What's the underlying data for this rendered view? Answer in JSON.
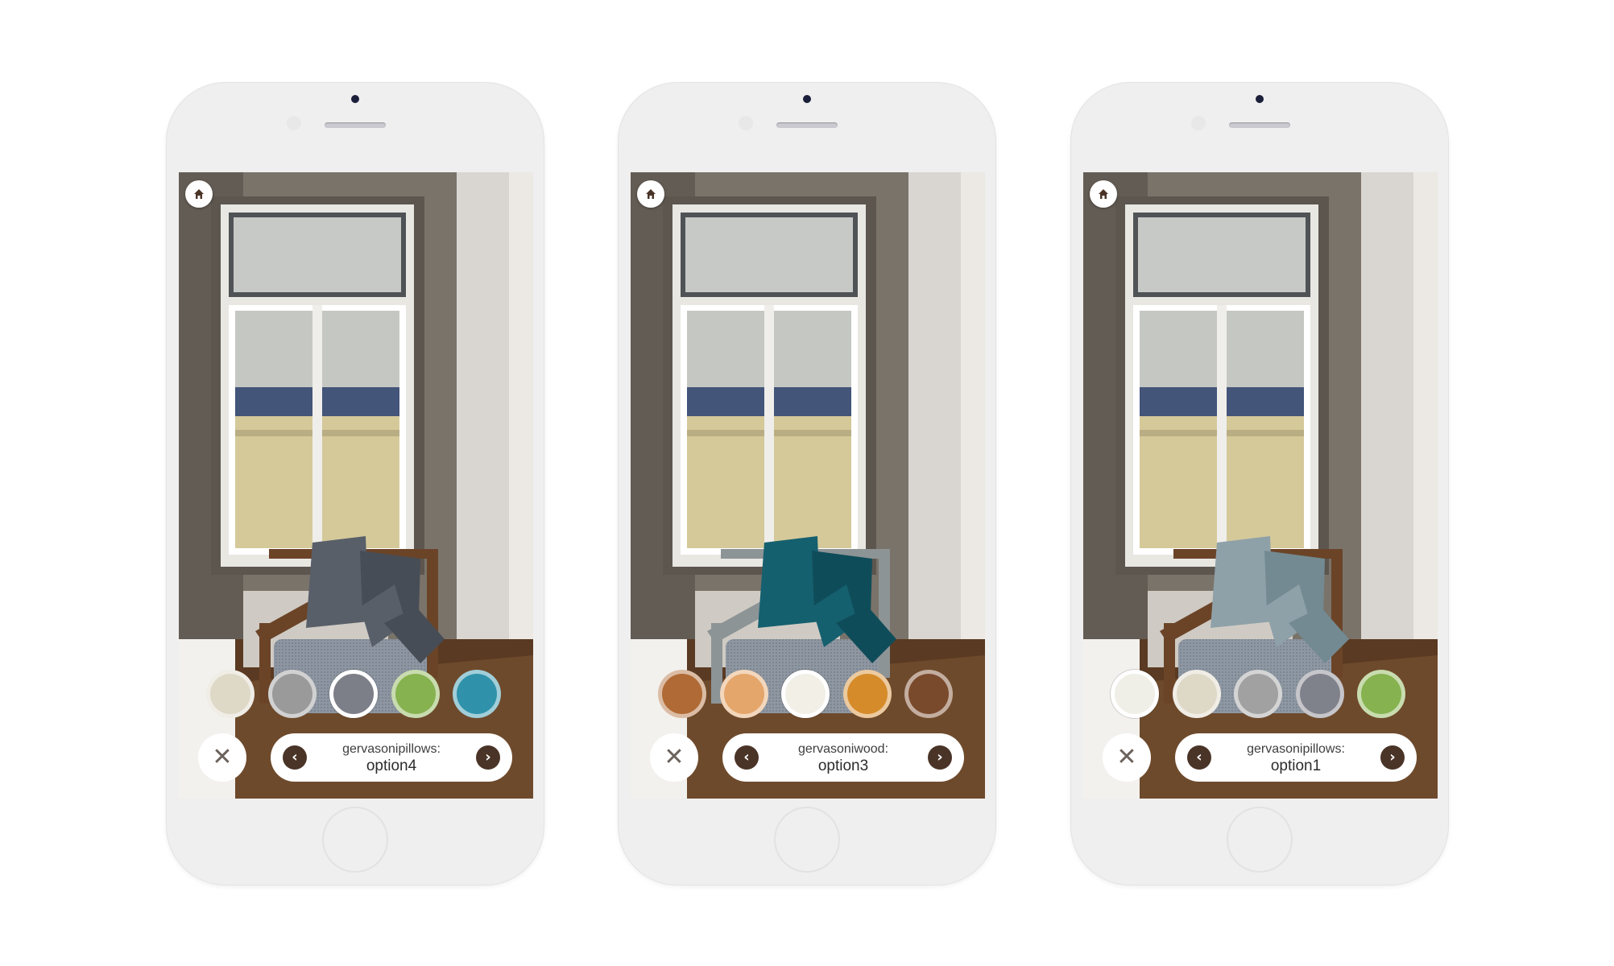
{
  "phones": [
    {
      "variant": "charcoal-pillows",
      "option_label": "gervasonipillows:",
      "option_value": "option4",
      "colors": {
        "pillow": "#585f69",
        "pillow_dark": "#474d56",
        "frame": "#6b4428",
        "seat": "#8d96a2"
      },
      "swatches": [
        {
          "name": "cream",
          "color": "#ded8c7"
        },
        {
          "name": "stripe-grey",
          "color": "#9a9a9a"
        },
        {
          "name": "houndstooth",
          "color": "#7d7f88",
          "selected": true
        },
        {
          "name": "green",
          "color": "#86b24f"
        },
        {
          "name": "teal",
          "color": "#2f92aa"
        }
      ]
    },
    {
      "variant": "teal-pillows-grey-wood",
      "option_label": "gervasoniwood:",
      "option_value": "option3",
      "colors": {
        "pillow": "#15606f",
        "pillow_dark": "#0f4c59",
        "frame": "#8d9496",
        "seat": "#8e97a2"
      },
      "swatches": [
        {
          "name": "wood-teak",
          "color": "#b06a35"
        },
        {
          "name": "wood-light",
          "color": "#e5a66b"
        },
        {
          "name": "wood-white",
          "color": "#f1efe6",
          "selected": true
        },
        {
          "name": "wood-amber",
          "color": "#d68b2a"
        },
        {
          "name": "wood-walnut",
          "color": "#7a4a2c"
        }
      ]
    },
    {
      "variant": "bluegrey-pillows",
      "option_label": "gervasonipillows:",
      "option_value": "option1",
      "colors": {
        "pillow": "#8fa1a8",
        "pillow_dark": "#738a92",
        "frame": "#6b4428",
        "seat": "#8e98a4"
      },
      "swatches": [
        {
          "name": "white",
          "color": "#efefe8",
          "selected": true
        },
        {
          "name": "cream",
          "color": "#ded8c7"
        },
        {
          "name": "stripe-grey",
          "color": "#a1a1a1"
        },
        {
          "name": "houndstooth",
          "color": "#80828b"
        },
        {
          "name": "green",
          "color": "#86b24f"
        }
      ]
    }
  ],
  "icons": {
    "home": "home-icon",
    "close": "close-icon",
    "prev": "chevron-left-icon",
    "next": "chevron-right-icon"
  },
  "glyphs": {
    "close": "✕",
    "prev": "‹",
    "next": "›"
  }
}
